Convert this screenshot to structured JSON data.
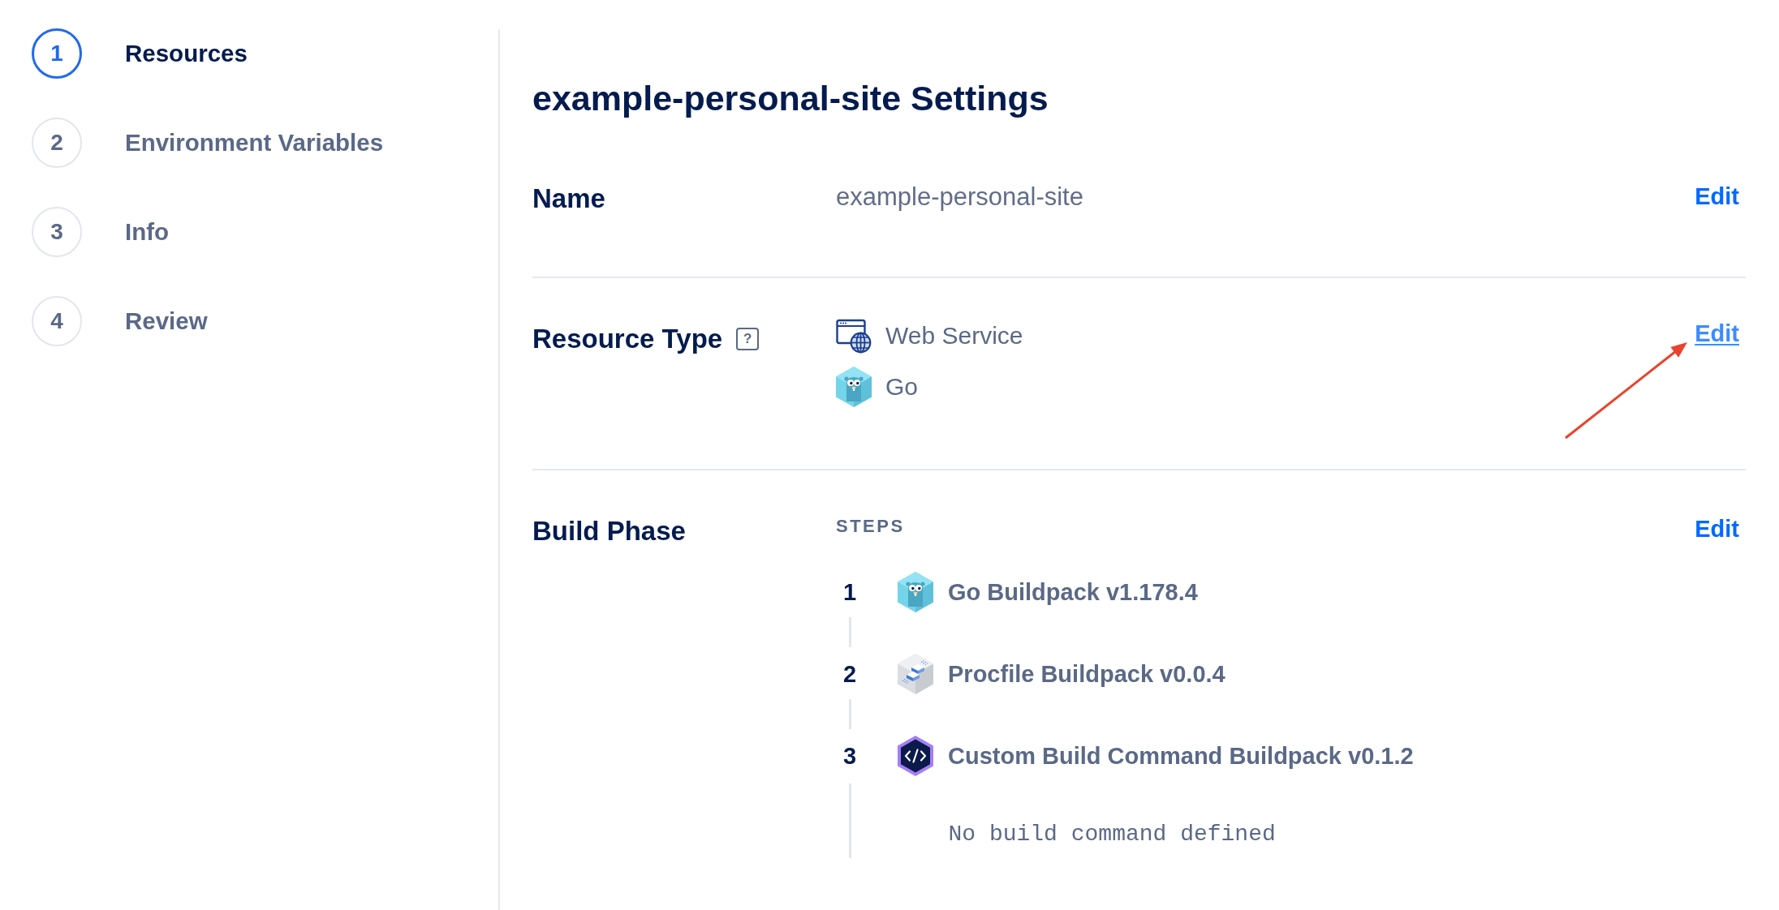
{
  "sidebar": {
    "steps": [
      {
        "number": "1",
        "label": "Resources",
        "selected": true
      },
      {
        "number": "2",
        "label": "Environment Variables",
        "selected": false
      },
      {
        "number": "3",
        "label": "Info",
        "selected": false
      },
      {
        "number": "4",
        "label": "Review",
        "selected": false
      }
    ]
  },
  "title": "example-personal-site Settings",
  "sections": [
    {
      "kind": "text",
      "label": "Name",
      "value": "example-personal-site",
      "edit": {
        "text": "Edit",
        "hovered": false,
        "annotated": false
      }
    },
    {
      "kind": "resource_list",
      "label": "Resource Type",
      "help": "?",
      "items": [
        {
          "kind": "web",
          "text": "Web Service"
        },
        {
          "kind": "go",
          "text": "Go"
        }
      ],
      "edit": {
        "text": "Edit",
        "hovered": true,
        "annotated": true
      }
    },
    {
      "kind": "steps",
      "label": "Build Phase",
      "heading": "STEPS",
      "steps": [
        {
          "number": "1",
          "kind": "go",
          "name": "Go Buildpack v1.178.4"
        },
        {
          "number": "2",
          "kind": "procfile",
          "name": "Procfile Buildpack v0.0.4"
        },
        {
          "number": "3",
          "kind": "custom",
          "name": "Custom Build Command Buildpack v0.1.2",
          "detail": "No build command defined"
        }
      ],
      "edit": {
        "text": "Edit",
        "hovered": false,
        "annotated": false
      }
    }
  ]
}
